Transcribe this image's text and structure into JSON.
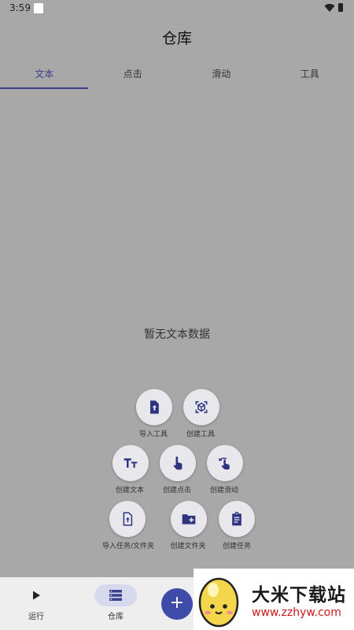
{
  "status_bar": {
    "time": "3:59"
  },
  "header": {
    "title": "仓库"
  },
  "tabs": [
    {
      "label": "文本",
      "active": true
    },
    {
      "label": "点击",
      "active": false
    },
    {
      "label": "滑动",
      "active": false
    },
    {
      "label": "工具",
      "active": false
    }
  ],
  "empty_state": {
    "message": "暂无文本数据"
  },
  "fab_menu": {
    "import_tool": "导入工具",
    "create_tool": "创建工具",
    "create_text": "创建文本",
    "create_click": "创建点击",
    "create_swipe": "创建滑动",
    "import_task_folder": "导入任务/文件夹",
    "create_folder": "创建文件夹",
    "create_task": "创建任务"
  },
  "bottom_nav": {
    "run_label": "运行",
    "repo_label": "仓库",
    "active": "仓库"
  },
  "main_fab": {
    "icon": "plus-icon",
    "symbol": "+"
  },
  "watermark": {
    "title": "大米下载站",
    "url": "www.zzhyw.com"
  },
  "colors": {
    "accent": "#3a3f8a",
    "overlay_bg": "#a8a8a8",
    "fab": "#3f4ca7",
    "nav_bg": "#eeeeef",
    "watermark_url": "#cc1a1a"
  }
}
